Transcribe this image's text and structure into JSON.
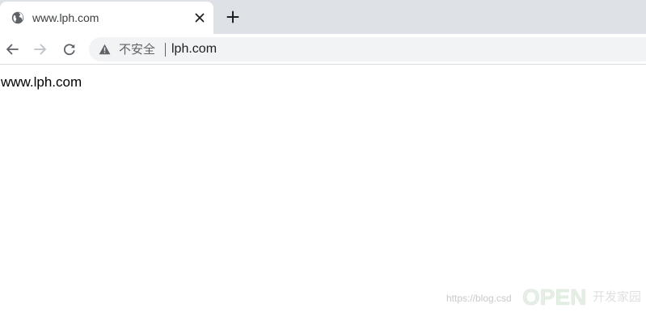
{
  "tab": {
    "title": "www.lph.com",
    "favicon_icon": "globe-icon",
    "close_icon": "close-icon"
  },
  "toolbar": {
    "new_tab_icon": "plus-icon",
    "back_icon": "arrow-left-icon",
    "forward_icon": "arrow-right-icon",
    "reload_icon": "reload-icon"
  },
  "omnibox": {
    "security_icon": "warning-icon",
    "security_label": "不安全",
    "url": "lph.com"
  },
  "page": {
    "body_text": "www.lph.com"
  },
  "watermark": {
    "url_text": "https://blog.csd",
    "logo_text": "OPEN",
    "logo_subtext": "开发家园"
  },
  "colors": {
    "tabstrip_bg": "#dee1e6",
    "omnibox_bg": "#f1f3f4",
    "icon_color": "#5f6368",
    "forward_disabled": "#bdc1c6"
  }
}
